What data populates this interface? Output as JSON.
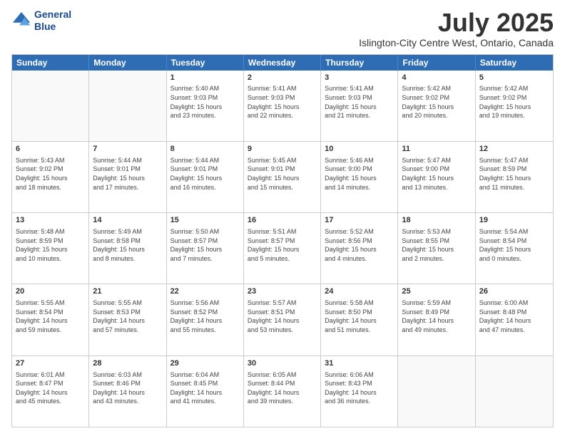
{
  "header": {
    "logo_line1": "General",
    "logo_line2": "Blue",
    "title": "July 2025",
    "subtitle": "Islington-City Centre West, Ontario, Canada"
  },
  "days_of_week": [
    "Sunday",
    "Monday",
    "Tuesday",
    "Wednesday",
    "Thursday",
    "Friday",
    "Saturday"
  ],
  "weeks": [
    [
      {
        "day": "",
        "info": ""
      },
      {
        "day": "",
        "info": ""
      },
      {
        "day": "1",
        "info": "Sunrise: 5:40 AM\nSunset: 9:03 PM\nDaylight: 15 hours\nand 23 minutes."
      },
      {
        "day": "2",
        "info": "Sunrise: 5:41 AM\nSunset: 9:03 PM\nDaylight: 15 hours\nand 22 minutes."
      },
      {
        "day": "3",
        "info": "Sunrise: 5:41 AM\nSunset: 9:03 PM\nDaylight: 15 hours\nand 21 minutes."
      },
      {
        "day": "4",
        "info": "Sunrise: 5:42 AM\nSunset: 9:02 PM\nDaylight: 15 hours\nand 20 minutes."
      },
      {
        "day": "5",
        "info": "Sunrise: 5:42 AM\nSunset: 9:02 PM\nDaylight: 15 hours\nand 19 minutes."
      }
    ],
    [
      {
        "day": "6",
        "info": "Sunrise: 5:43 AM\nSunset: 9:02 PM\nDaylight: 15 hours\nand 18 minutes."
      },
      {
        "day": "7",
        "info": "Sunrise: 5:44 AM\nSunset: 9:01 PM\nDaylight: 15 hours\nand 17 minutes."
      },
      {
        "day": "8",
        "info": "Sunrise: 5:44 AM\nSunset: 9:01 PM\nDaylight: 15 hours\nand 16 minutes."
      },
      {
        "day": "9",
        "info": "Sunrise: 5:45 AM\nSunset: 9:01 PM\nDaylight: 15 hours\nand 15 minutes."
      },
      {
        "day": "10",
        "info": "Sunrise: 5:46 AM\nSunset: 9:00 PM\nDaylight: 15 hours\nand 14 minutes."
      },
      {
        "day": "11",
        "info": "Sunrise: 5:47 AM\nSunset: 9:00 PM\nDaylight: 15 hours\nand 13 minutes."
      },
      {
        "day": "12",
        "info": "Sunrise: 5:47 AM\nSunset: 8:59 PM\nDaylight: 15 hours\nand 11 minutes."
      }
    ],
    [
      {
        "day": "13",
        "info": "Sunrise: 5:48 AM\nSunset: 8:59 PM\nDaylight: 15 hours\nand 10 minutes."
      },
      {
        "day": "14",
        "info": "Sunrise: 5:49 AM\nSunset: 8:58 PM\nDaylight: 15 hours\nand 8 minutes."
      },
      {
        "day": "15",
        "info": "Sunrise: 5:50 AM\nSunset: 8:57 PM\nDaylight: 15 hours\nand 7 minutes."
      },
      {
        "day": "16",
        "info": "Sunrise: 5:51 AM\nSunset: 8:57 PM\nDaylight: 15 hours\nand 5 minutes."
      },
      {
        "day": "17",
        "info": "Sunrise: 5:52 AM\nSunset: 8:56 PM\nDaylight: 15 hours\nand 4 minutes."
      },
      {
        "day": "18",
        "info": "Sunrise: 5:53 AM\nSunset: 8:55 PM\nDaylight: 15 hours\nand 2 minutes."
      },
      {
        "day": "19",
        "info": "Sunrise: 5:54 AM\nSunset: 8:54 PM\nDaylight: 15 hours\nand 0 minutes."
      }
    ],
    [
      {
        "day": "20",
        "info": "Sunrise: 5:55 AM\nSunset: 8:54 PM\nDaylight: 14 hours\nand 59 minutes."
      },
      {
        "day": "21",
        "info": "Sunrise: 5:55 AM\nSunset: 8:53 PM\nDaylight: 14 hours\nand 57 minutes."
      },
      {
        "day": "22",
        "info": "Sunrise: 5:56 AM\nSunset: 8:52 PM\nDaylight: 14 hours\nand 55 minutes."
      },
      {
        "day": "23",
        "info": "Sunrise: 5:57 AM\nSunset: 8:51 PM\nDaylight: 14 hours\nand 53 minutes."
      },
      {
        "day": "24",
        "info": "Sunrise: 5:58 AM\nSunset: 8:50 PM\nDaylight: 14 hours\nand 51 minutes."
      },
      {
        "day": "25",
        "info": "Sunrise: 5:59 AM\nSunset: 8:49 PM\nDaylight: 14 hours\nand 49 minutes."
      },
      {
        "day": "26",
        "info": "Sunrise: 6:00 AM\nSunset: 8:48 PM\nDaylight: 14 hours\nand 47 minutes."
      }
    ],
    [
      {
        "day": "27",
        "info": "Sunrise: 6:01 AM\nSunset: 8:47 PM\nDaylight: 14 hours\nand 45 minutes."
      },
      {
        "day": "28",
        "info": "Sunrise: 6:03 AM\nSunset: 8:46 PM\nDaylight: 14 hours\nand 43 minutes."
      },
      {
        "day": "29",
        "info": "Sunrise: 6:04 AM\nSunset: 8:45 PM\nDaylight: 14 hours\nand 41 minutes."
      },
      {
        "day": "30",
        "info": "Sunrise: 6:05 AM\nSunset: 8:44 PM\nDaylight: 14 hours\nand 39 minutes."
      },
      {
        "day": "31",
        "info": "Sunrise: 6:06 AM\nSunset: 8:43 PM\nDaylight: 14 hours\nand 36 minutes."
      },
      {
        "day": "",
        "info": ""
      },
      {
        "day": "",
        "info": ""
      }
    ]
  ]
}
